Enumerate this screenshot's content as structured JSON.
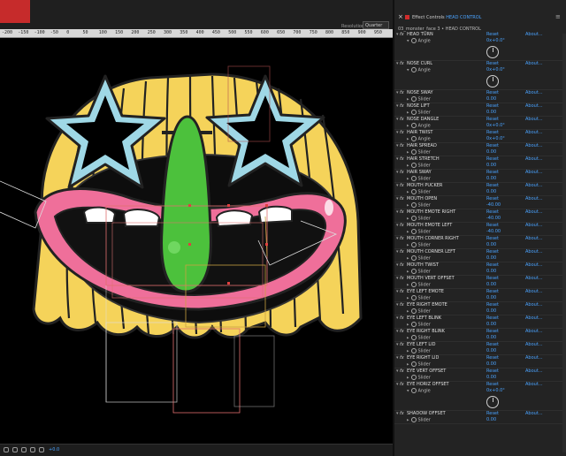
{
  "viewer": {
    "resolution_label": "Resolution",
    "resolution_value": "Quarter",
    "ruler_ticks": [
      "-200",
      "-150",
      "-100",
      "-50",
      "0",
      "50",
      "100",
      "150",
      "200",
      "250",
      "300",
      "350",
      "400",
      "450",
      "500",
      "550",
      "600",
      "650",
      "700",
      "750",
      "800",
      "850",
      "900",
      "950"
    ],
    "zoom_readout": "+0.0"
  },
  "panel": {
    "close_glyph": "×",
    "title_prefix": "Effect Controls",
    "title_layer": "HEAD CONTROL",
    "menu_glyph": "≡",
    "comp_path": "03_monster_face 3 • HEAD CONTROL",
    "reset_label": "Reset",
    "about_label": "About...",
    "effects": [
      {
        "name": "HEAD TURN",
        "prop": "Angle",
        "value": "0x+0.0°",
        "control": "angle"
      },
      {
        "name": "NOSE CURL",
        "prop": "Angle",
        "value": "0x+0.0°",
        "control": "angle"
      },
      {
        "name": "NOSE SWAY",
        "prop": "Slider",
        "value": "0.00",
        "control": "slider"
      },
      {
        "name": "NOSE LIFT",
        "prop": "Slider",
        "value": "0.00",
        "control": "slider"
      },
      {
        "name": "NOSE DANGLE",
        "prop": "Angle",
        "value": "0x+0.0°",
        "control": "angle-collapsed"
      },
      {
        "name": "HAIR TWIST",
        "prop": "Angle",
        "value": "0x+0.0°",
        "control": "angle-collapsed"
      },
      {
        "name": "HAIR SPREAD",
        "prop": "Slider",
        "value": "0.00",
        "control": "slider"
      },
      {
        "name": "HAIR STRETCH",
        "prop": "Slider",
        "value": "0.00",
        "control": "slider"
      },
      {
        "name": "HAIR SWAY",
        "prop": "Slider",
        "value": "0.00",
        "control": "slider"
      },
      {
        "name": "MOUTH PUCKER",
        "prop": "Slider",
        "value": "0.00",
        "control": "slider"
      },
      {
        "name": "MOUTH OPEN",
        "prop": "Slider",
        "value": "-40.00",
        "control": "slider"
      },
      {
        "name": "MOUTH EMOTE RIGHT",
        "prop": "Slider",
        "value": "-40.00",
        "control": "slider"
      },
      {
        "name": "MOUTH EMOTE LEFT",
        "prop": "Slider",
        "value": "-40.00",
        "control": "slider"
      },
      {
        "name": "MOUTH CORNER RIGHT",
        "prop": "Slider",
        "value": "0.00",
        "control": "slider"
      },
      {
        "name": "MOUTH CORNER LEFT",
        "prop": "Slider",
        "value": "0.00",
        "control": "slider"
      },
      {
        "name": "MOUTH TWIST",
        "prop": "Slider",
        "value": "0.00",
        "control": "slider"
      },
      {
        "name": "MOUTH VERT OFFSET",
        "prop": "Slider",
        "value": "0.00",
        "control": "slider"
      },
      {
        "name": "EYE LEFT EMOTE",
        "prop": "Slider",
        "value": "0.00",
        "control": "slider"
      },
      {
        "name": "EYE RIGHT EMOTE",
        "prop": "Slider",
        "value": "0.00",
        "control": "slider"
      },
      {
        "name": "EYE LEFT BLINK",
        "prop": "Slider",
        "value": "0.00",
        "control": "slider"
      },
      {
        "name": "EYE RIGHT BLINK",
        "prop": "Slider",
        "value": "0.00",
        "control": "slider"
      },
      {
        "name": "EYE LEFT LID",
        "prop": "Slider",
        "value": "0.00",
        "control": "slider"
      },
      {
        "name": "EYE RIGHT LID",
        "prop": "Slider",
        "value": "0.00",
        "control": "slider"
      },
      {
        "name": "EYE VERT OFFSET",
        "prop": "Slider",
        "value": "0.00",
        "control": "slider"
      },
      {
        "name": "EYE HORIZ OFFSET",
        "prop": "Angle",
        "value": "0x+0.0°",
        "control": "angle"
      },
      {
        "name": "SHADOW OFFSET",
        "prop": "Slider",
        "value": "0.00",
        "control": "slider"
      }
    ]
  },
  "colors": {
    "accent": "#4aa3ff",
    "hair": "#f5d35a",
    "star": "#9fd8e6",
    "nose": "#4cc13c",
    "lips": "#ef6f9a",
    "tab": "#c62b2b"
  }
}
